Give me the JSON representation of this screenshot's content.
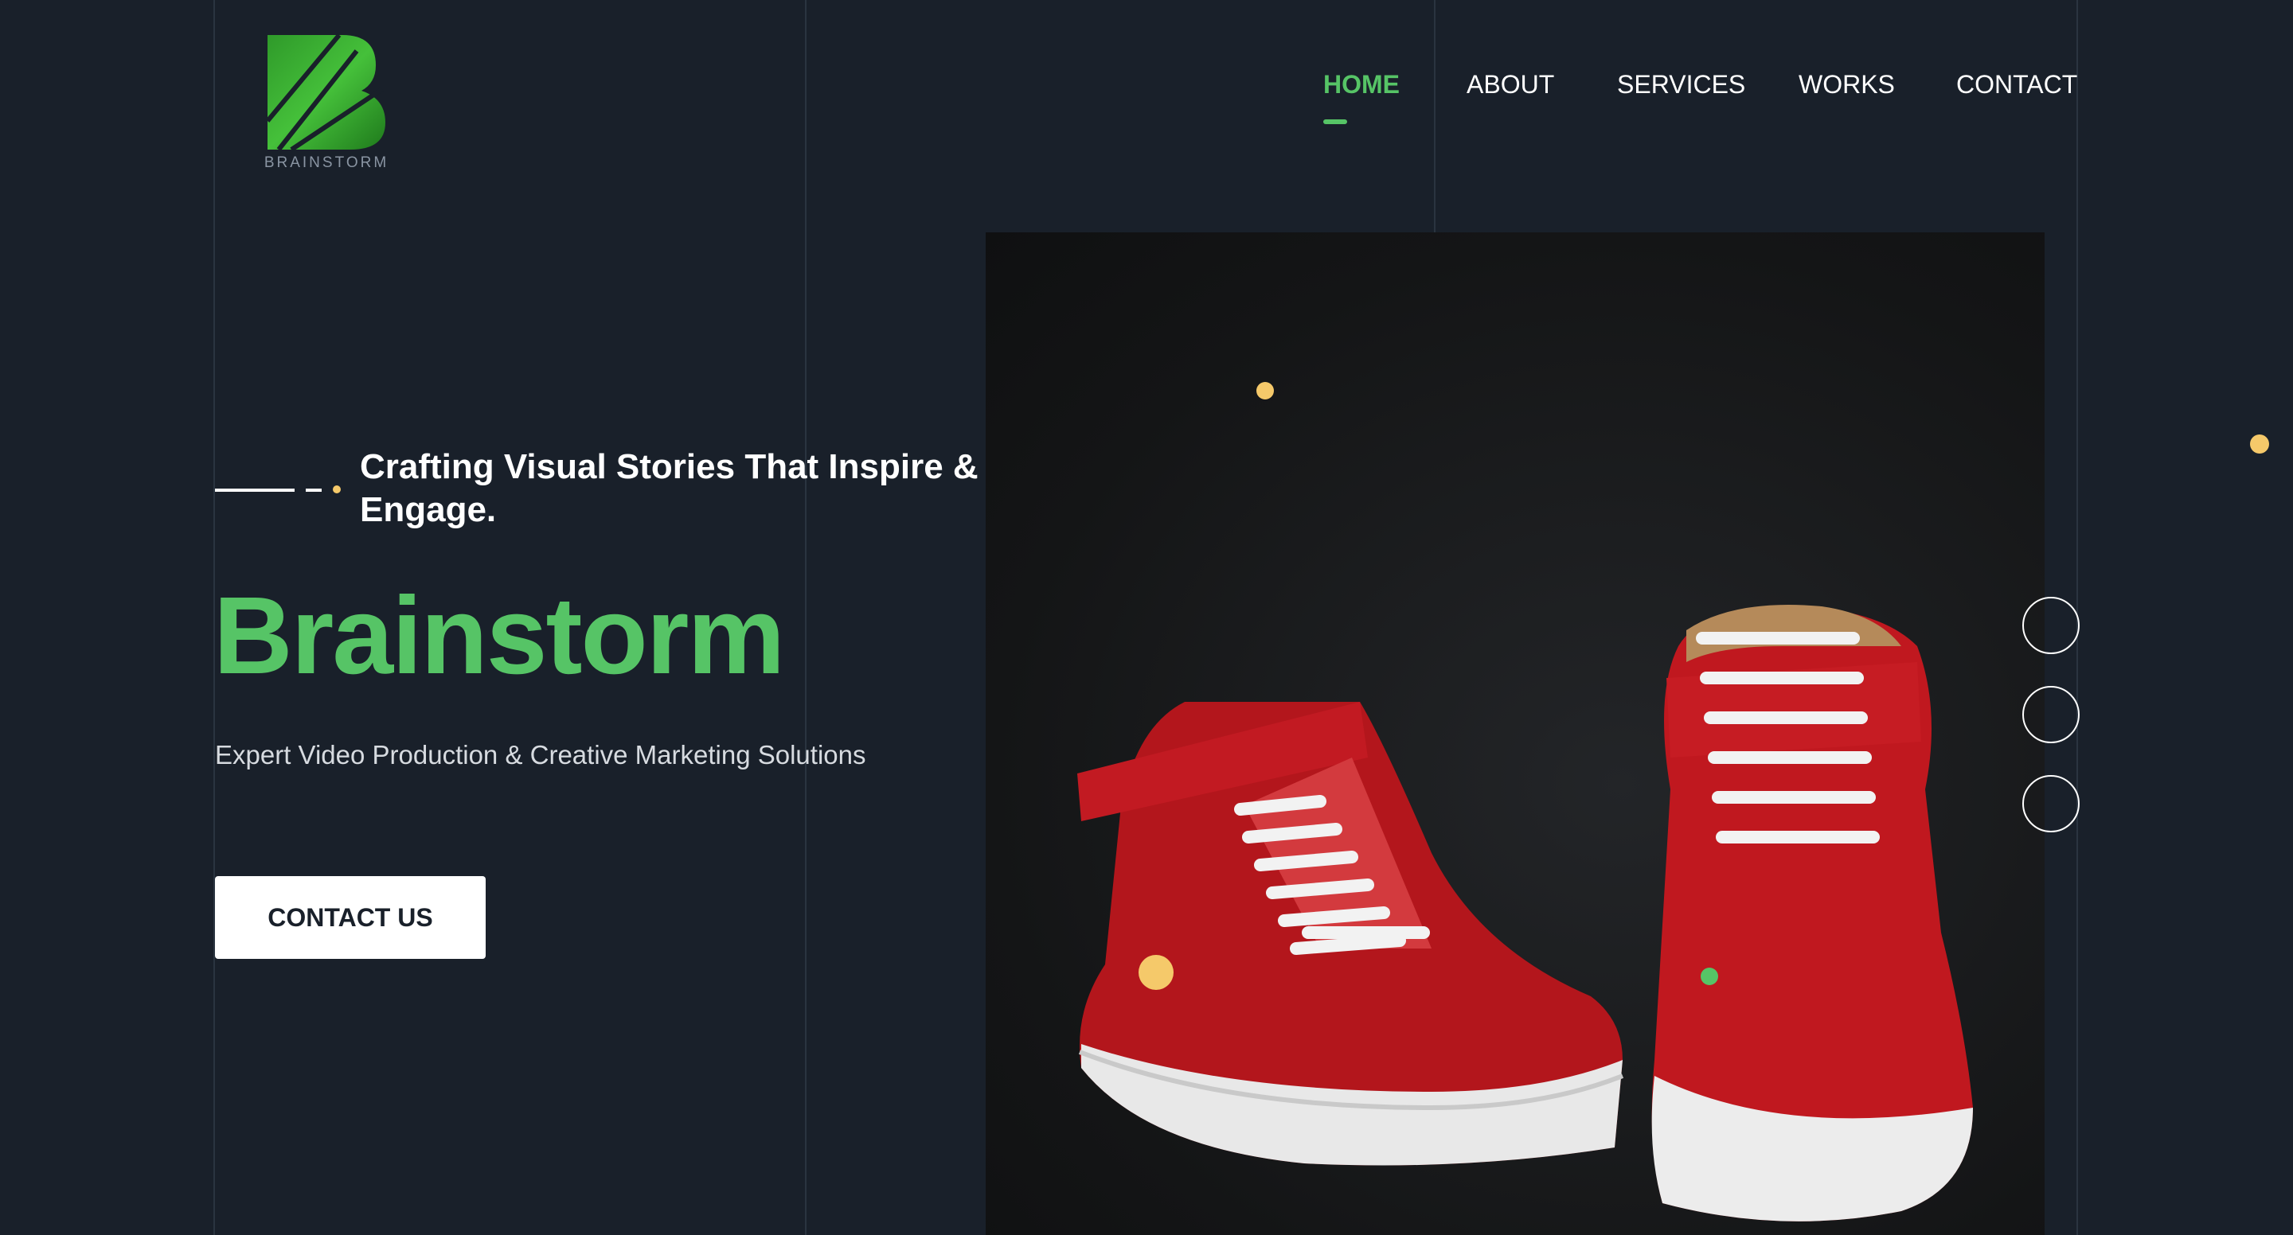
{
  "logo": {
    "text": "BRAINSTORM"
  },
  "nav": {
    "items": [
      {
        "label": "HOME",
        "active": true
      },
      {
        "label": "ABOUT",
        "active": false
      },
      {
        "label": "SERVICES",
        "active": false
      },
      {
        "label": "WORKS",
        "active": false
      },
      {
        "label": "CONTACT",
        "active": false
      }
    ]
  },
  "hero": {
    "tagline": "Crafting Visual Stories That Inspire & Engage.",
    "brand": "Brainstorm",
    "subtitle": "Expert Video Production & Creative Marketing Solutions",
    "cta_label": "CONTACT US",
    "image_icon": "red-high-top-sneakers-image"
  },
  "slider": {
    "dots": [
      "slide-1",
      "slide-2",
      "slide-3"
    ]
  },
  "colors": {
    "background": "#19202a",
    "accent_green": "#56c466",
    "accent_yellow": "#f5c96a",
    "text_white": "#ffffff",
    "subtitle_text": "#d7dbe0"
  }
}
